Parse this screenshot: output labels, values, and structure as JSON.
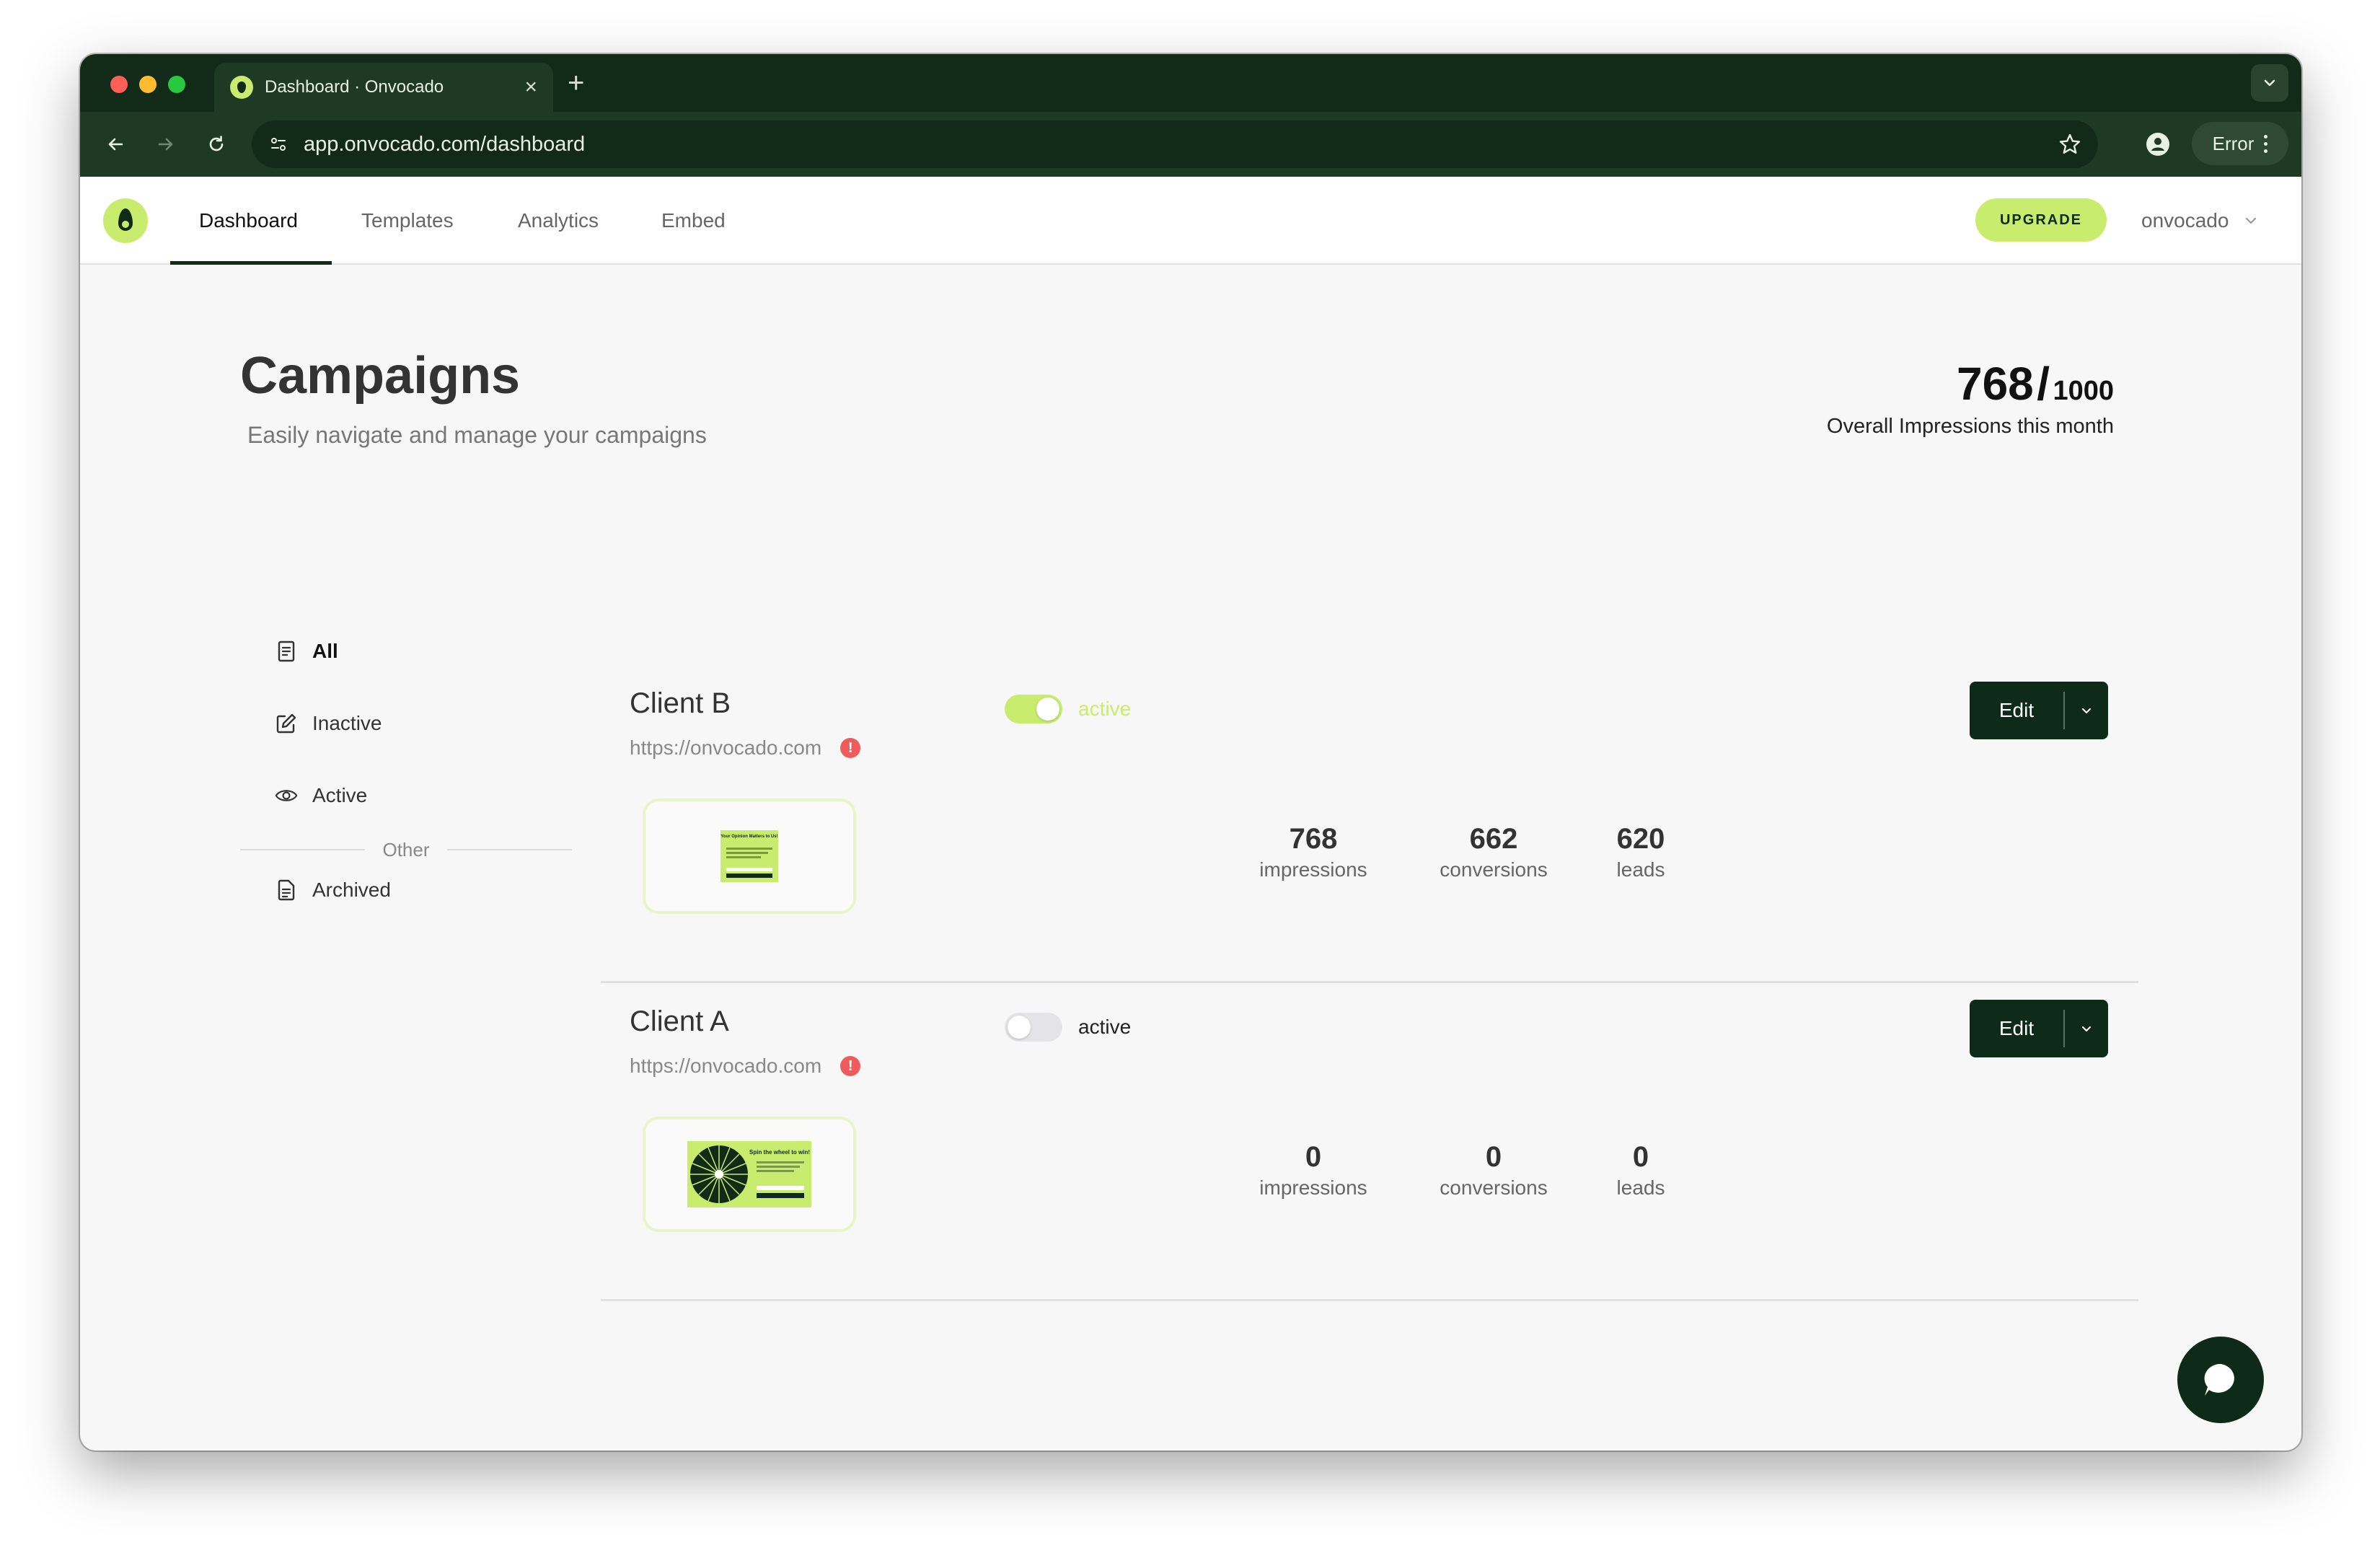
{
  "browser": {
    "tab_title": "Dashboard · Onvocado",
    "close_glyph": "×",
    "new_tab_glyph": "+",
    "url": "app.onvocado.com/dashboard",
    "profile_status": "Error"
  },
  "header": {
    "nav": [
      {
        "label": "Dashboard",
        "active": true
      },
      {
        "label": "Templates",
        "active": false
      },
      {
        "label": "Analytics",
        "active": false
      },
      {
        "label": "Embed",
        "active": false
      }
    ],
    "upgrade_label": "UPGRADE",
    "account_name": "onvocado"
  },
  "page": {
    "title": "Campaigns",
    "subtitle": "Easily navigate and manage your campaigns",
    "usage": {
      "used": "768",
      "slash": "/",
      "limit": "1000",
      "label": "Overall Impressions this month"
    }
  },
  "filters": {
    "items": [
      {
        "label": "All",
        "icon": "document-icon",
        "active": true
      },
      {
        "label": "Inactive",
        "icon": "edit-icon",
        "active": false
      },
      {
        "label": "Active",
        "icon": "eye-icon",
        "active": false
      }
    ],
    "divider_label": "Other",
    "archived": {
      "label": "Archived",
      "icon": "archive-document-icon"
    }
  },
  "campaigns": [
    {
      "name": "Client B",
      "url": "https://onvocado.com",
      "warning_glyph": "!",
      "status_label": "active",
      "is_active": true,
      "edit_label": "Edit",
      "preview_title": "Your Opinion Matters to Us!",
      "metrics": [
        {
          "value": "768",
          "label": "impressions"
        },
        {
          "value": "662",
          "label": "conversions"
        },
        {
          "value": "620",
          "label": "leads"
        }
      ]
    },
    {
      "name": "Client A",
      "url": "https://onvocado.com",
      "warning_glyph": "!",
      "status_label": "active",
      "is_active": false,
      "edit_label": "Edit",
      "preview_title": "Spin the wheel to win!",
      "metrics": [
        {
          "value": "0",
          "label": "impressions"
        },
        {
          "value": "0",
          "label": "conversions"
        },
        {
          "value": "0",
          "label": "leads"
        }
      ]
    }
  ],
  "colors": {
    "brand_dark": "#122a18",
    "brand_lime": "#c8ec6e",
    "warning_red": "#ef5a5a"
  }
}
